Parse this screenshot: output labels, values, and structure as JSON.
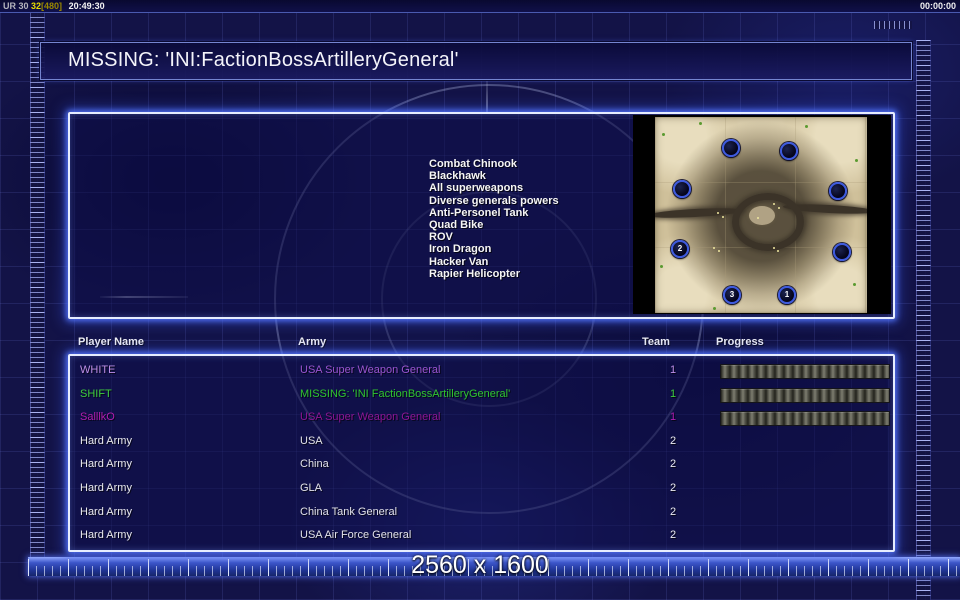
{
  "status_bar": {
    "debug_label": "UR 30",
    "fps": "32",
    "res_tag": "[480]",
    "clock": "20:49:30",
    "match_timer": "00:00:00"
  },
  "title_bar": {
    "title": "MISSING: 'INI:FactionBossArtilleryGeneral'"
  },
  "briefing": {
    "features": [
      "Combat Chinook",
      "Blackhawk",
      "All superweapons",
      "Diverse generals powers",
      "Anti-Personel Tank",
      "Quad Bike",
      "ROV",
      "Iron Dragon",
      "Hacker Van",
      "Rapier Helicopter"
    ]
  },
  "minimap": {
    "spot_labels": [
      "",
      "",
      "",
      "",
      "2",
      "",
      "3",
      "1"
    ]
  },
  "table": {
    "columns": [
      "Player Name",
      "Army",
      "Team",
      "Progress"
    ],
    "rows": [
      {
        "name": "WHITE",
        "army": "USA Super Weapon General",
        "team": "1",
        "color": "#bd8fe8",
        "army_color": "#9a55d0"
      },
      {
        "name": "SHIFT",
        "army": "MISSING: 'INI FactionBossArtilleryGeneral'",
        "team": "1",
        "color": "#3ecd3e",
        "army_color": "#2fc52f"
      },
      {
        "name": "SalllkO",
        "army": "USA Super Weapon General",
        "team": "1",
        "color": "#b01eb0",
        "army_color": "#8d1694"
      },
      {
        "name": "Hard Army",
        "army": "USA",
        "team": "2",
        "color": "#eaeaf0",
        "army_color": "#e2e2ea"
      },
      {
        "name": "Hard Army",
        "army": "China",
        "team": "2",
        "color": "#eaeaf0",
        "army_color": "#e2e2ea"
      },
      {
        "name": "Hard Army",
        "army": "GLA",
        "team": "2",
        "color": "#eaeaf0",
        "army_color": "#e2e2ea"
      },
      {
        "name": "Hard Army",
        "army": "China Tank General",
        "team": "2",
        "color": "#eaeaf0",
        "army_color": "#e2e2ea"
      },
      {
        "name": "Hard Army",
        "army": "USA Air Force General",
        "team": "2",
        "color": "#eaeaf0",
        "army_color": "#e2e2ea"
      }
    ]
  },
  "footer": {
    "resolution": "2560 x 1600"
  },
  "colors": {
    "glow_accent": "#7f9bff",
    "background": "#131347",
    "spot_ring": "#3d5ae0",
    "progress_segment_light": "#7d7d70",
    "progress_segment_dark": "#23231c"
  }
}
